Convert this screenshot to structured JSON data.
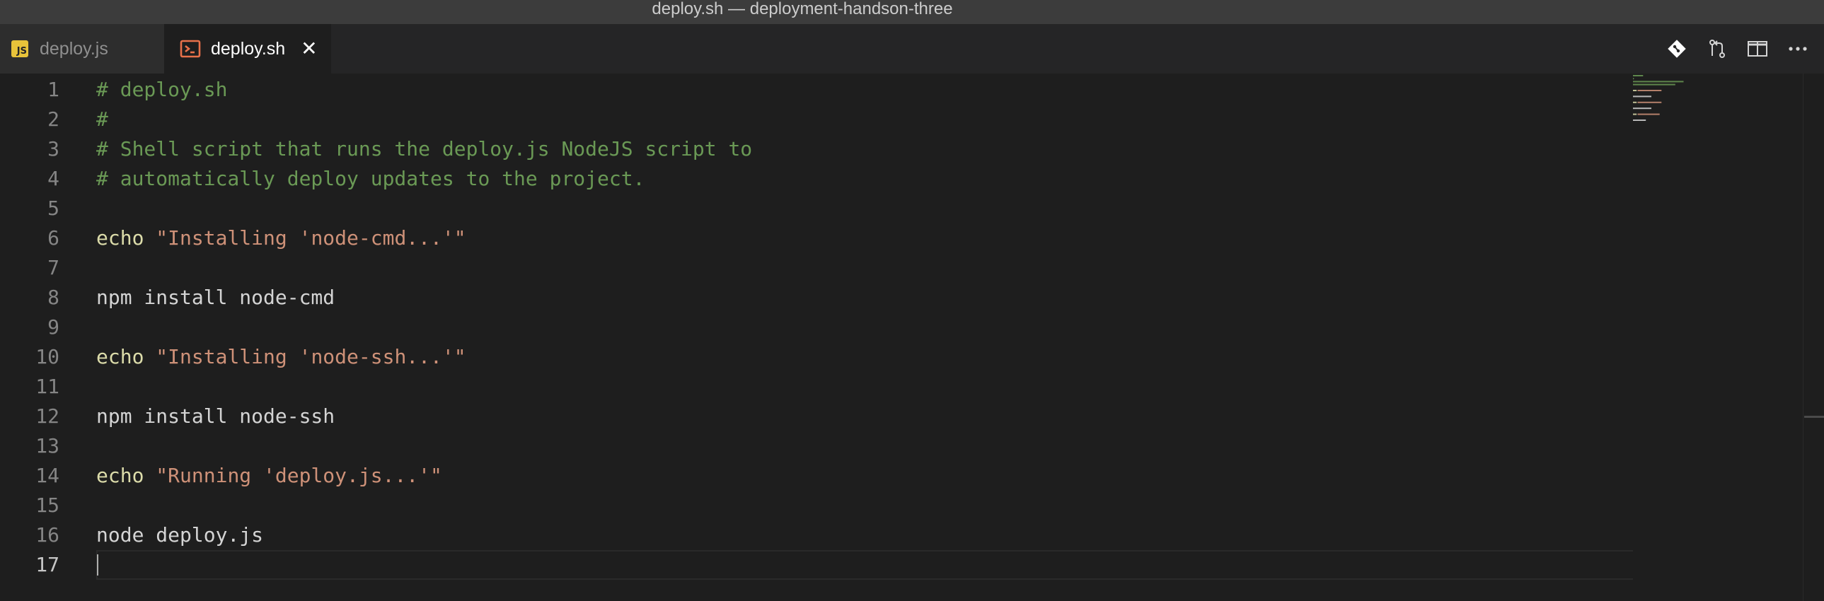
{
  "window": {
    "title": "deploy.sh — deployment-handson-three"
  },
  "tabs": [
    {
      "label": "deploy.js",
      "icon": "js-file-icon",
      "active": false
    },
    {
      "label": "deploy.sh",
      "icon": "terminal-file-icon",
      "active": true,
      "close": "✕"
    }
  ],
  "actions": [
    {
      "name": "git-compare-icon"
    },
    {
      "name": "open-changes-icon"
    },
    {
      "name": "split-editor-icon"
    },
    {
      "name": "more-actions-icon",
      "label": "···"
    }
  ],
  "editor": {
    "current_line": 17,
    "lines": [
      {
        "n": "1",
        "tokens": [
          {
            "t": "# deploy.sh",
            "c": "comment"
          }
        ]
      },
      {
        "n": "2",
        "tokens": [
          {
            "t": "#",
            "c": "comment"
          }
        ]
      },
      {
        "n": "3",
        "tokens": [
          {
            "t": "# Shell script that runs the deploy.js NodeJS script to",
            "c": "comment"
          }
        ]
      },
      {
        "n": "4",
        "tokens": [
          {
            "t": "# automatically deploy updates to the project.",
            "c": "comment"
          }
        ]
      },
      {
        "n": "5",
        "tokens": []
      },
      {
        "n": "6",
        "tokens": [
          {
            "t": "echo",
            "c": "builtin"
          },
          {
            "t": " ",
            "c": "plain"
          },
          {
            "t": "\"Installing 'node-cmd...'\"",
            "c": "string"
          }
        ]
      },
      {
        "n": "7",
        "tokens": []
      },
      {
        "n": "8",
        "tokens": [
          {
            "t": "npm install node-cmd",
            "c": "plain"
          }
        ]
      },
      {
        "n": "9",
        "tokens": []
      },
      {
        "n": "10",
        "tokens": [
          {
            "t": "echo",
            "c": "builtin"
          },
          {
            "t": " ",
            "c": "plain"
          },
          {
            "t": "\"Installing 'node-ssh...'\"",
            "c": "string"
          }
        ]
      },
      {
        "n": "11",
        "tokens": []
      },
      {
        "n": "12",
        "tokens": [
          {
            "t": "npm install node-ssh",
            "c": "plain"
          }
        ]
      },
      {
        "n": "13",
        "tokens": []
      },
      {
        "n": "14",
        "tokens": [
          {
            "t": "echo",
            "c": "builtin"
          },
          {
            "t": " ",
            "c": "plain"
          },
          {
            "t": "\"Running 'deploy.js...'\"",
            "c": "string"
          }
        ]
      },
      {
        "n": "15",
        "tokens": []
      },
      {
        "n": "16",
        "tokens": [
          {
            "t": "node deploy.js",
            "c": "plain"
          }
        ]
      },
      {
        "n": "17",
        "tokens": []
      }
    ]
  },
  "colors": {
    "comment": "#6a9955",
    "builtin": "#dcdcaa",
    "string": "#ce9178",
    "plain": "#d4d4d4",
    "js_icon": "#e8c33a",
    "terminal_icon": "#e8714a"
  }
}
